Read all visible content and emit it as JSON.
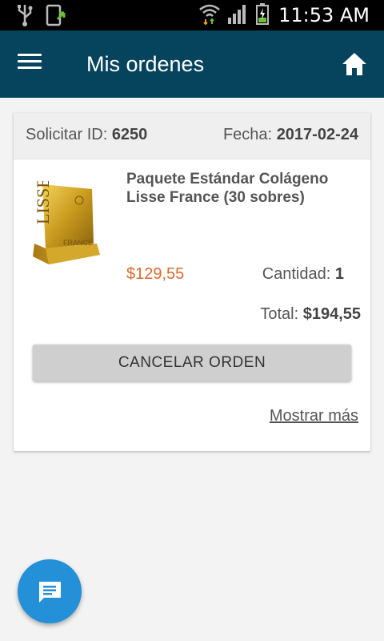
{
  "status_bar": {
    "time": "11:53 AM",
    "icons": [
      "usb-icon",
      "device-sync-icon",
      "wifi-icon",
      "signal-icon",
      "battery-charging-icon"
    ]
  },
  "app_bar": {
    "title": "Mis ordenes",
    "menu_icon": "hamburger-menu-icon",
    "home_icon": "home-icon",
    "background_color": "#06445e"
  },
  "order": {
    "id_label": "Solicitar ID:",
    "id_value": "6250",
    "date_label": "Fecha:",
    "date_value": "2017-02-24",
    "product": {
      "name": "Paquete Estándar Colágeno Lisse France (30 sobres)",
      "image_text_lisse": "LISSE",
      "image_text_france": "FRANCE",
      "price": "$129,55",
      "price_color": "#d96a2e"
    },
    "quantity_label": "Cantidad:",
    "quantity_value": "1",
    "total_label": "Total:",
    "total_value": "$194,55",
    "cancel_button": "CANCELAR ORDEN",
    "more_link": "Mostrar más"
  },
  "fab": {
    "icon": "chat-icon",
    "color": "#2390d8"
  }
}
